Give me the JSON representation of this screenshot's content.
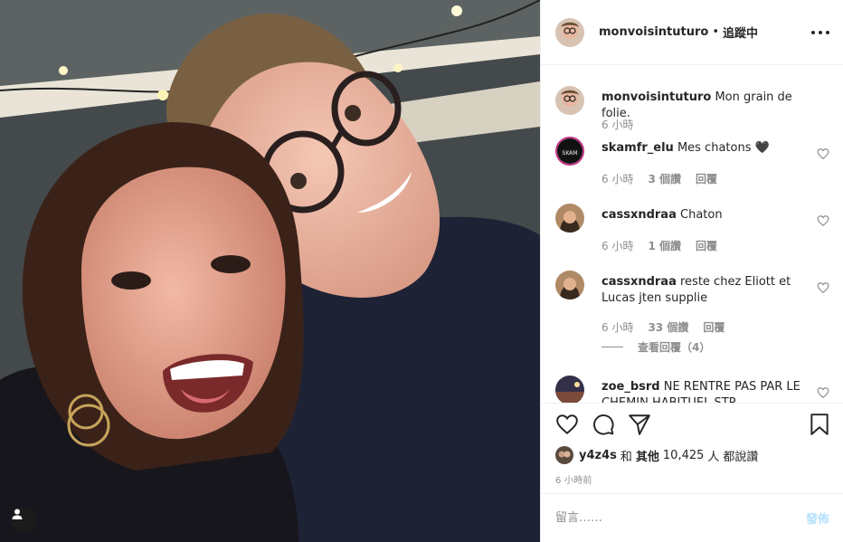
{
  "post": {
    "username": "monvoisintuturo",
    "separator": "•",
    "follow_status": "追蹤中"
  },
  "comments": [
    {
      "user": "monvoisintuturo",
      "text": "Mon grain de folie.",
      "time": "6 小時"
    },
    {
      "user": "skamfr_elu",
      "text": "Mes chatons 🖤",
      "time": "6 小時",
      "likes": "3 個讚",
      "reply": "回覆",
      "avatar_text": "SKAM"
    },
    {
      "user": "cassxndraa",
      "text": "Chaton",
      "time": "6 小時",
      "likes": "1 個讚",
      "reply": "回覆"
    },
    {
      "user": "cassxndraa",
      "text": "reste chez Eliott et Lucas jten supplie",
      "time": "6 小時",
      "likes": "33 個讚",
      "reply": "回覆",
      "view_replies": "查看回覆（4）"
    },
    {
      "user": "zoe_bsrd",
      "text": "NE RENTRE PAS PAR LE CHEMIN HABITUEL STP"
    }
  ],
  "likes": {
    "first_user": "y4z4s",
    "and": "和",
    "others": "其他",
    "count": "10,425",
    "people": "人",
    "suffix": "都說讚"
  },
  "timestamp": "6 小時前",
  "add_comment": {
    "placeholder": "留言……",
    "post_label": "發佈"
  },
  "colors": {
    "text": "#262626",
    "secondary": "#8e8e8e",
    "border": "#efefef",
    "post_disabled": "#b2dffc"
  }
}
